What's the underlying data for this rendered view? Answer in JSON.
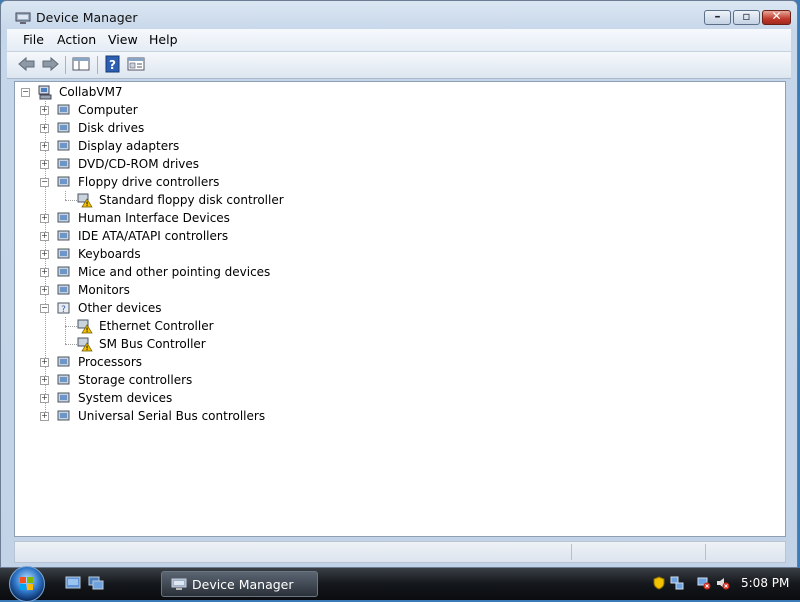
{
  "window": {
    "title": "Device Manager",
    "controls": {
      "minimize": "–",
      "maximize": "▫",
      "close": "✕"
    }
  },
  "menu": [
    "File",
    "Action",
    "Help",
    "View"
  ],
  "menubar": {
    "file": "File",
    "action": "Action",
    "view": "View",
    "help": "Help"
  },
  "toolbar": {
    "buttons": [
      "back-icon",
      "forward-icon",
      "show-hide-console-tree-icon",
      "help-icon",
      "properties-icon"
    ]
  },
  "tree": {
    "root": "CollabVM7",
    "nodes": [
      {
        "label": "Computer",
        "expanded": false,
        "icon": "computer-icon"
      },
      {
        "label": "Disk drives",
        "expanded": false,
        "icon": "disk-drive-icon"
      },
      {
        "label": "Display adapters",
        "expanded": false,
        "icon": "display-adapter-icon"
      },
      {
        "label": "DVD/CD-ROM drives",
        "expanded": false,
        "icon": "dvd-drive-icon"
      },
      {
        "label": "Floppy drive controllers",
        "expanded": true,
        "icon": "floppy-controller-icon",
        "children": [
          {
            "label": "Standard floppy disk controller",
            "icon": "warning-device-icon"
          }
        ]
      },
      {
        "label": "Human Interface Devices",
        "expanded": false,
        "icon": "hid-icon"
      },
      {
        "label": "IDE ATA/ATAPI controllers",
        "expanded": false,
        "icon": "ide-controller-icon"
      },
      {
        "label": "Keyboards",
        "expanded": false,
        "icon": "keyboard-icon"
      },
      {
        "label": "Mice and other pointing devices",
        "expanded": false,
        "icon": "mouse-icon"
      },
      {
        "label": "Monitors",
        "expanded": false,
        "icon": "monitor-icon"
      },
      {
        "label": "Other devices",
        "expanded": true,
        "icon": "unknown-device-icon",
        "children": [
          {
            "label": "Ethernet Controller",
            "icon": "warning-device-icon"
          },
          {
            "label": "SM Bus Controller",
            "icon": "warning-device-icon"
          }
        ]
      },
      {
        "label": "Processors",
        "expanded": false,
        "icon": "processor-icon"
      },
      {
        "label": "Storage controllers",
        "expanded": false,
        "icon": "storage-controller-icon"
      },
      {
        "label": "System devices",
        "expanded": false,
        "icon": "system-device-icon"
      },
      {
        "label": "Universal Serial Bus controllers",
        "expanded": false,
        "icon": "usb-icon"
      }
    ]
  },
  "taskbar": {
    "task_button": "Device Manager",
    "clock": "5:08 PM"
  },
  "colors": {
    "warning": "#f2c200",
    "accent": "#2f76c8"
  }
}
